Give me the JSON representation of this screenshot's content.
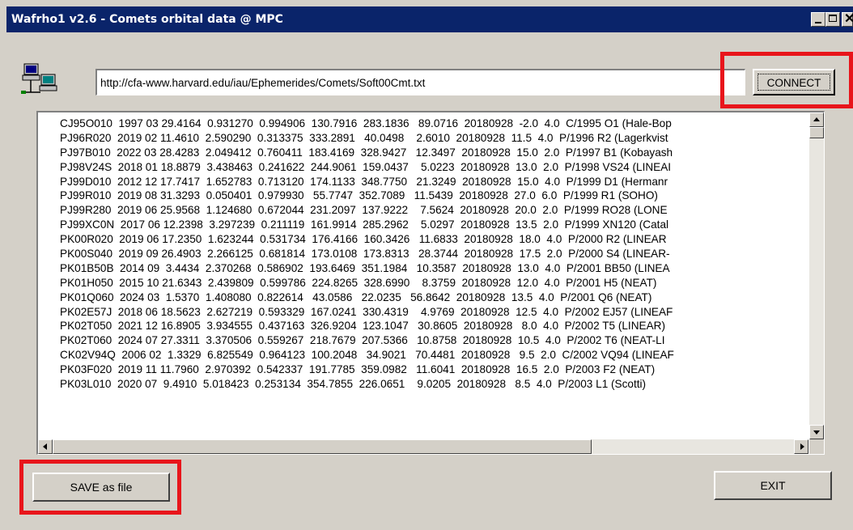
{
  "window": {
    "title": "Wafrho1 v2.6 - Comets orbital data @ MPC"
  },
  "titlebar_buttons": [
    "minimize-icon",
    "maximize-icon",
    "close-icon"
  ],
  "url_field": {
    "value": "http://cfa-www.harvard.edu/iau/Ephemerides/Comets/Soft00Cmt.txt"
  },
  "buttons": {
    "connect": "CONNECT",
    "save": "SAVE as file",
    "exit": "EXIT"
  },
  "icons": {
    "network": "network-computers-icon"
  },
  "colors": {
    "titlebar": "#0a246a",
    "window_face": "#d4d0c8",
    "highlight_box": "#e8151b"
  },
  "data_rows": [
    "CJ95O010  1997 03 29.4164  0.931270  0.994906  130.7916  283.1836   89.0716  20180928  -2.0  4.0  C/1995 O1 (Hale-Bop",
    "PJ96R020  2019 02 11.4610  2.590290  0.313375  333.2891   40.0498    2.6010  20180928  11.5  4.0  P/1996 R2 (Lagerkvist",
    "PJ97B010  2022 03 28.4283  2.049412  0.760411  183.4169  328.9427   12.3497  20180928  15.0  2.0  P/1997 B1 (Kobayash",
    "PJ98V24S  2018 01 18.8879  3.438463  0.241622  244.9061  159.0437    5.0223  20180928  13.0  2.0  P/1998 VS24 (LINEAI",
    "PJ99D010  2012 12 17.7417  1.652783  0.713120  174.1133  348.7750   21.3249  20180928  15.0  4.0  P/1999 D1 (Hermanr",
    "PJ99R010  2019 08 31.3293  0.050401  0.979930   55.7747  352.7089   11.5439  20180928  27.0  6.0  P/1999 R1 (SOHO)",
    "PJ99R280  2019 06 25.9568  1.124680  0.672044  231.2097  137.9222    7.5624  20180928  20.0  2.0  P/1999 RO28 (LONE",
    "PJ99XC0N  2017 06 12.2398  3.297239  0.211119  161.9914  285.2962    5.0297  20180928  13.5  2.0  P/1999 XN120 (Catal",
    "PK00R020  2019 06 17.2350  1.623244  0.531734  176.4166  160.3426   11.6833  20180928  18.0  4.0  P/2000 R2 (LINEAR",
    "PK00S040  2019 09 26.4903  2.266125  0.681814  173.0108  173.8313   28.3744  20180928  17.5  2.0  P/2000 S4 (LINEAR-",
    "PK01B50B  2014 09  3.4434  2.370268  0.586902  193.6469  351.1984   10.3587  20180928  13.0  4.0  P/2001 BB50 (LINEA",
    "PK01H050  2015 10 21.6343  2.439809  0.599786  224.8265  328.6990    8.3759  20180928  12.0  4.0  P/2001 H5 (NEAT)",
    "PK01Q060  2024 03  1.5370  1.408080  0.822614   43.0586   22.0235   56.8642  20180928  13.5  4.0  P/2001 Q6 (NEAT)",
    "PK02E57J  2018 06 18.5623  2.627219  0.593329  167.0241  330.4319    4.9769  20180928  12.5  4.0  P/2002 EJ57 (LINEAF",
    "PK02T050  2021 12 16.8905  3.934555  0.437163  326.9204  123.1047   30.8605  20180928   8.0  4.0  P/2002 T5 (LINEAR)",
    "PK02T060  2024 07 27.3311  3.370506  0.559267  218.7679  207.5366   10.8758  20180928  10.5  4.0  P/2002 T6 (NEAT-LI",
    "CK02V94Q  2006 02  1.3329  6.825549  0.964123  100.2048   34.9021   70.4481  20180928   9.5  2.0  C/2002 VQ94 (LINEAF",
    "PK03F020  2019 11 11.7960  2.970392  0.542337  191.7785  359.0982   11.6041  20180928  16.5  2.0  P/2003 F2 (NEAT)",
    "PK03L010  2020 07  9.4910  5.018423  0.253134  354.7855  226.0651    9.0205  20180928   8.5  4.0  P/2003 L1 (Scotti)"
  ]
}
